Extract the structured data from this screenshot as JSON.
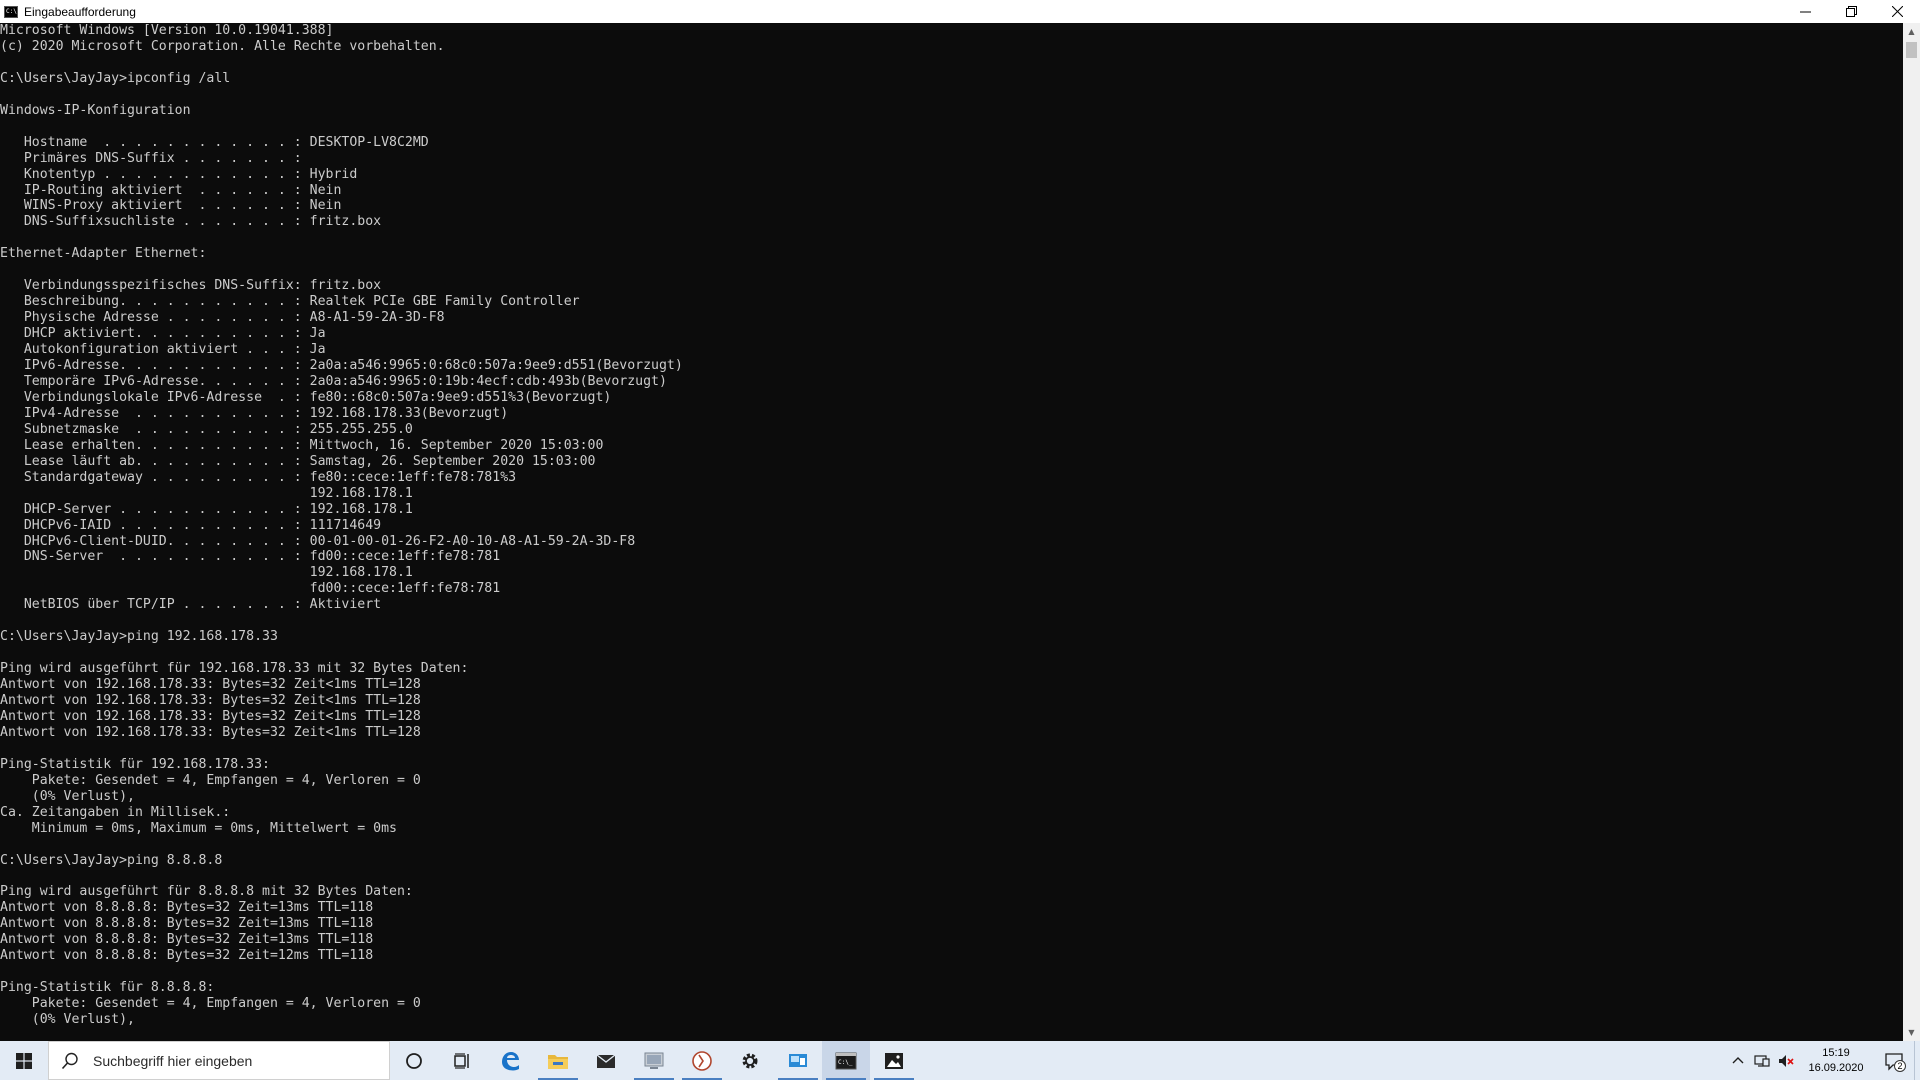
{
  "window": {
    "title": "Eingabeaufforderung"
  },
  "console": {
    "lines": [
      "Microsoft Windows [Version 10.0.19041.388]",
      "(c) 2020 Microsoft Corporation. Alle Rechte vorbehalten.",
      "",
      "C:\\Users\\JayJay>ipconfig /all",
      "",
      "Windows-IP-Konfiguration",
      "",
      "   Hostname  . . . . . . . . . . . . : DESKTOP-LV8C2MD",
      "   Primäres DNS-Suffix . . . . . . . :",
      "   Knotentyp . . . . . . . . . . . . : Hybrid",
      "   IP-Routing aktiviert  . . . . . . : Nein",
      "   WINS-Proxy aktiviert  . . . . . . : Nein",
      "   DNS-Suffixsuchliste . . . . . . . : fritz.box",
      "",
      "Ethernet-Adapter Ethernet:",
      "",
      "   Verbindungsspezifisches DNS-Suffix: fritz.box",
      "   Beschreibung. . . . . . . . . . . : Realtek PCIe GBE Family Controller",
      "   Physische Adresse . . . . . . . . : A8-A1-59-2A-3D-F8",
      "   DHCP aktiviert. . . . . . . . . . : Ja",
      "   Autokonfiguration aktiviert . . . : Ja",
      "   IPv6-Adresse. . . . . . . . . . . : 2a0a:a546:9965:0:68c0:507a:9ee9:d551(Bevorzugt)",
      "   Temporäre IPv6-Adresse. . . . . . : 2a0a:a546:9965:0:19b:4ecf:cdb:493b(Bevorzugt)",
      "   Verbindungslokale IPv6-Adresse  . : fe80::68c0:507a:9ee9:d551%3(Bevorzugt)",
      "   IPv4-Adresse  . . . . . . . . . . : 192.168.178.33(Bevorzugt)",
      "   Subnetzmaske  . . . . . . . . . . : 255.255.255.0",
      "   Lease erhalten. . . . . . . . . . : Mittwoch, 16. September 2020 15:03:00",
      "   Lease läuft ab. . . . . . . . . . : Samstag, 26. September 2020 15:03:00",
      "   Standardgateway . . . . . . . . . : fe80::cece:1eff:fe78:781%3",
      "                                       192.168.178.1",
      "   DHCP-Server . . . . . . . . . . . : 192.168.178.1",
      "   DHCPv6-IAID . . . . . . . . . . . : 111714649",
      "   DHCPv6-Client-DUID. . . . . . . . : 00-01-00-01-26-F2-A0-10-A8-A1-59-2A-3D-F8",
      "   DNS-Server  . . . . . . . . . . . : fd00::cece:1eff:fe78:781",
      "                                       192.168.178.1",
      "                                       fd00::cece:1eff:fe78:781",
      "   NetBIOS über TCP/IP . . . . . . . : Aktiviert",
      "",
      "C:\\Users\\JayJay>ping 192.168.178.33",
      "",
      "Ping wird ausgeführt für 192.168.178.33 mit 32 Bytes Daten:",
      "Antwort von 192.168.178.33: Bytes=32 Zeit<1ms TTL=128",
      "Antwort von 192.168.178.33: Bytes=32 Zeit<1ms TTL=128",
      "Antwort von 192.168.178.33: Bytes=32 Zeit<1ms TTL=128",
      "Antwort von 192.168.178.33: Bytes=32 Zeit<1ms TTL=128",
      "",
      "Ping-Statistik für 192.168.178.33:",
      "    Pakete: Gesendet = 4, Empfangen = 4, Verloren = 0",
      "    (0% Verlust),",
      "Ca. Zeitangaben in Millisek.:",
      "    Minimum = 0ms, Maximum = 0ms, Mittelwert = 0ms",
      "",
      "C:\\Users\\JayJay>ping 8.8.8.8",
      "",
      "Ping wird ausgeführt für 8.8.8.8 mit 32 Bytes Daten:",
      "Antwort von 8.8.8.8: Bytes=32 Zeit=13ms TTL=118",
      "Antwort von 8.8.8.8: Bytes=32 Zeit=13ms TTL=118",
      "Antwort von 8.8.8.8: Bytes=32 Zeit=13ms TTL=118",
      "Antwort von 8.8.8.8: Bytes=32 Zeit=12ms TTL=118",
      "",
      "Ping-Statistik für 8.8.8.8:",
      "    Pakete: Gesendet = 4, Empfangen = 4, Verloren = 0",
      "    (0% Verlust),"
    ],
    "text_color": "#cccccc",
    "background": "#0c0c0c"
  },
  "taskbar": {
    "search_placeholder": "Suchbegriff hier eingeben",
    "apps": [
      {
        "name": "cortana-icon"
      },
      {
        "name": "task-view-icon"
      },
      {
        "name": "edge-icon"
      },
      {
        "name": "file-explorer-icon"
      },
      {
        "name": "mail-icon"
      },
      {
        "name": "network-app-icon"
      },
      {
        "name": "media-app-icon"
      },
      {
        "name": "settings-gear-icon"
      },
      {
        "name": "remote-desktop-icon"
      },
      {
        "name": "command-prompt-icon"
      },
      {
        "name": "photos-icon"
      }
    ],
    "clock_time": "15:19",
    "clock_date": "16.09.2020",
    "notification_count": "2",
    "background": "#e3ebf5"
  }
}
